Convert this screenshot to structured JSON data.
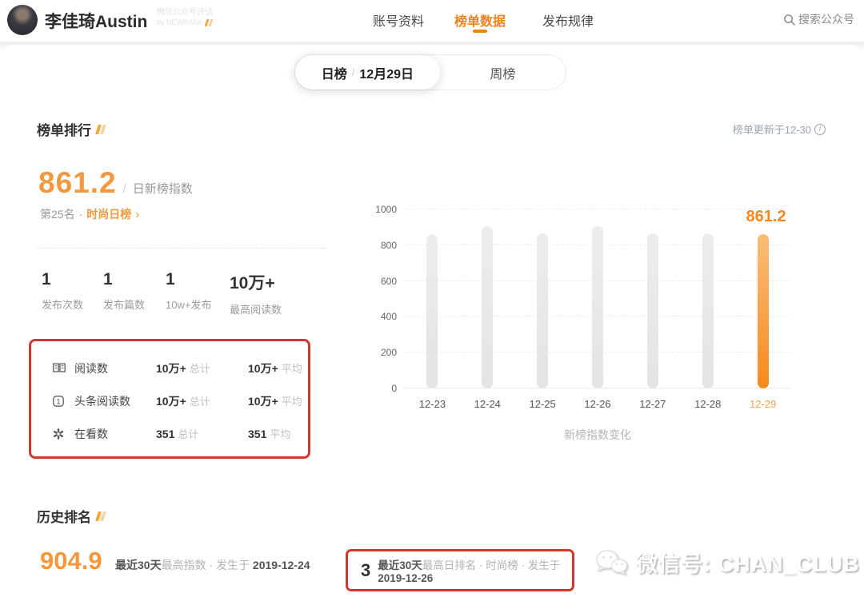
{
  "header": {
    "account_name": "李佳琦Austin",
    "brand_line1": "微信公众号评估",
    "brand_line2": "by NEWRANK",
    "nav": [
      {
        "label": "账号资料",
        "active": false
      },
      {
        "label": "榜单数据",
        "active": true
      },
      {
        "label": "发布规律",
        "active": false
      }
    ],
    "search_label": "搜索公众号"
  },
  "tabs": {
    "daily_label": "日榜",
    "separator": "/",
    "daily_date": "12月29日",
    "weekly_label": "周榜"
  },
  "ranking_section": {
    "title": "榜单排行",
    "updated_note": "榜单更新于12-30",
    "index_value": "861.2",
    "index_slash": "/",
    "index_label": "日新榜指数",
    "rank_label": "第25名",
    "rank_dot": "·",
    "rank_list": "时尚日榜",
    "rank_arrow": "›",
    "stats": [
      {
        "value": "1",
        "label": "发布次数"
      },
      {
        "value": "1",
        "label": "发布篇数"
      },
      {
        "value": "1",
        "label": "10w+发布"
      },
      {
        "value": "10万+",
        "label": "最高阅读数"
      }
    ],
    "detail_rows": [
      {
        "icon": "book-open-icon",
        "label": "阅读数",
        "total": "10万+",
        "total_label": "总计",
        "avg": "10万+",
        "avg_label": "平均"
      },
      {
        "icon": "headline-read-icon",
        "label": "头条阅读数",
        "total": "10万+",
        "total_label": "总计",
        "avg": "10万+",
        "avg_label": "平均"
      },
      {
        "icon": "wow-flower-icon",
        "label": "在看数",
        "total": "351",
        "total_label": "总计",
        "avg": "351",
        "avg_label": "平均"
      }
    ]
  },
  "chart_data": {
    "type": "bar",
    "title": "新榜指数变化",
    "categories": [
      "12-23",
      "12-24",
      "12-25",
      "12-26",
      "12-27",
      "12-28",
      "12-29"
    ],
    "values": [
      860,
      905,
      865,
      905,
      865,
      865,
      861.2
    ],
    "highlight_index": 6,
    "highlight_label": "861.2",
    "ylim": [
      0,
      1000
    ],
    "yticks": [
      0,
      200,
      400,
      600,
      800,
      1000
    ],
    "grid": "dashed-horizontal",
    "bar_color": "#e8e8e8",
    "highlight_color": "#f58a1e"
  },
  "history_section": {
    "title": "历史排名",
    "highest_index": {
      "value": "904.9",
      "prefix": "最近30天",
      "mid": "最高指数 · 发生于 ",
      "date": "2019-12-24"
    },
    "highest_rank": {
      "value": "3",
      "prefix": "最近30天",
      "mid": "最高日排名 · 时尚榜 · 发生于",
      "date": "2019-12-26"
    }
  },
  "watermark": {
    "label": "微信号: CHAN_CLUB"
  },
  "colors": {
    "accent_orange": "#f0821e",
    "index_orange": "#f5973d",
    "annotation_red": "#ce3a30",
    "bar_gray": "#e8e8e8",
    "bar_highlight": "#f58a1e"
  }
}
